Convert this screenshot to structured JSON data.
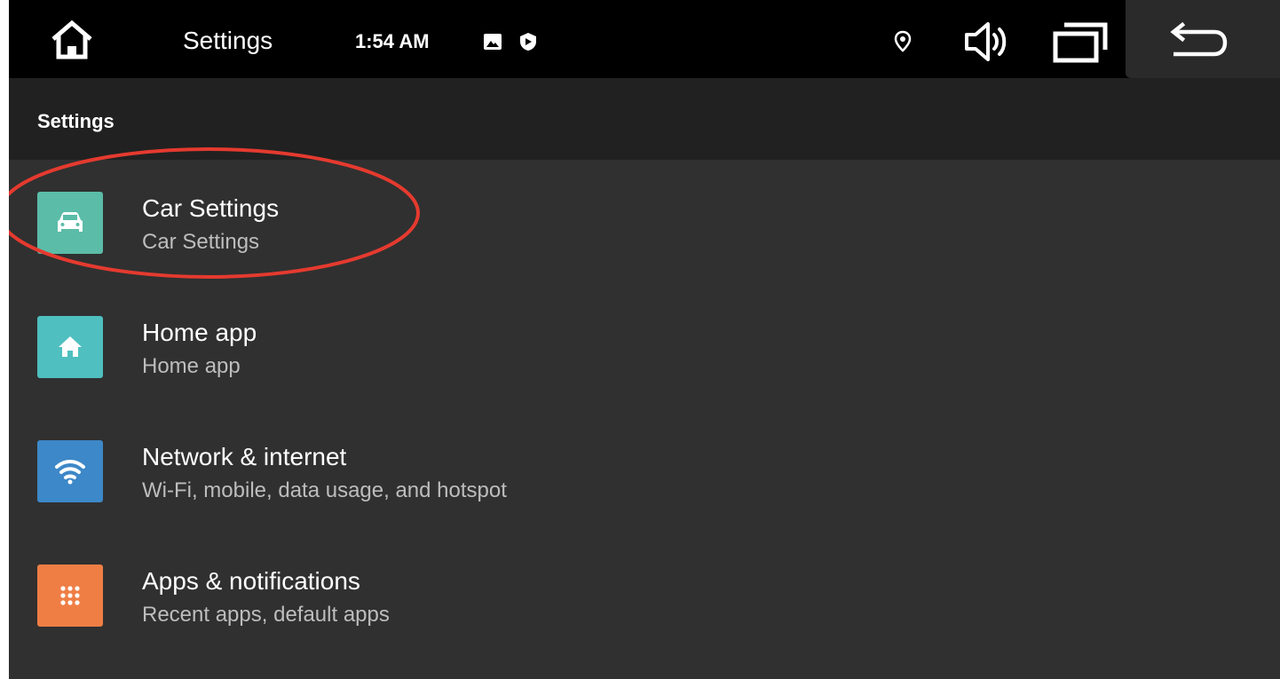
{
  "status_bar": {
    "title": "Settings",
    "time": "1:54 AM",
    "notification_icons": [
      "image-notification-icon",
      "shield-notification-icon"
    ],
    "right_icons": [
      "location-icon",
      "volume-icon",
      "recent-apps-icon",
      "back-icon"
    ]
  },
  "page": {
    "title": "Settings"
  },
  "settings": {
    "items": [
      {
        "title": "Car Settings",
        "subtitle": "Car Settings",
        "icon": "car-icon",
        "color": "#5bbca8"
      },
      {
        "title": "Home app",
        "subtitle": "Home app",
        "icon": "home-icon",
        "color": "#4fbfbf"
      },
      {
        "title": "Network & internet",
        "subtitle": "Wi-Fi, mobile, data usage, and hotspot",
        "icon": "wifi-icon",
        "color": "#3d88c8"
      },
      {
        "title": "Apps & notifications",
        "subtitle": "Recent apps, default apps",
        "icon": "apps-grid-icon",
        "color": "#ef7e45"
      }
    ]
  },
  "annotation": {
    "highlight_color": "#e53a2f",
    "highlighted_item": "Car Settings"
  }
}
